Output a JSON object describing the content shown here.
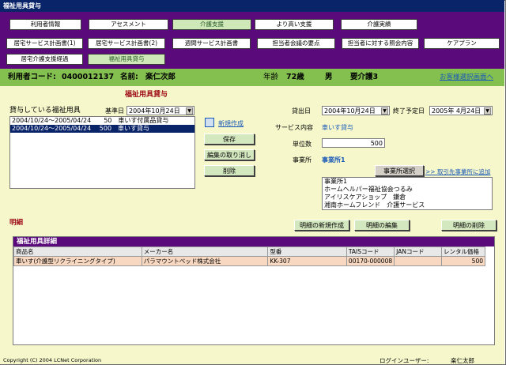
{
  "window": {
    "title": "福祉用具貸与"
  },
  "nav_top": [
    "利用者情報",
    "アセスメント",
    "介護支援",
    "より高い支援",
    "介護実績"
  ],
  "nav_sub": [
    "居宅サービス計画書(1)",
    "居宅サービス計画書(2)",
    "週間サービス計画書",
    "担当者会議の要点",
    "担当者に対する照会内容",
    "ケアプラン",
    "居宅介護支援経過",
    "福祉用具貸与"
  ],
  "patient": {
    "code_label": "利用者コード:",
    "code": "0400012137",
    "name_label": "名前:",
    "name": "楽仁次郎",
    "age_label": "年齢",
    "age": "72歳",
    "sex": "男",
    "care_level": "要介護3",
    "back_link": "お客様選択画面へ"
  },
  "section_title": "福祉用具貸与",
  "rental_list": {
    "label": "貸与している福祉用具",
    "base_date_label": "基準日",
    "base_date": "2004年10月24日",
    "rows": [
      "2004/10/24～2005/04/24　　50　車いす付属品貸与",
      "2004/10/24～2005/04/24　 500　車いす貸与"
    ]
  },
  "actions": {
    "new": "新規作成",
    "save": "保存",
    "cancel_edit": "編集の取り消し",
    "delete": "削除"
  },
  "form": {
    "start_label": "貸出日",
    "start_date": "2004年10月24日",
    "end_label": "終了予定日",
    "end_date": "2005年 4月24日",
    "service_label": "サービス内容",
    "service_value": "車いす貸与",
    "units_label": "単位数",
    "units_value": "500",
    "office_label": "事業所",
    "office_value": "事業所1",
    "office_select": "事業所選択",
    "add_supplier": ">> 取引先事業所に追加",
    "offices": [
      "事業所1",
      "ホームヘルパー福祉協会つるみ",
      "アイリスケアショップ　鎌倉",
      "湘南ホームフレンド　介護サービス"
    ]
  },
  "detail": {
    "label": "明細",
    "new": "明細の新規作成",
    "edit": "明細の編集",
    "delete": "明細の削除",
    "grid_title": "福祉用具詳細",
    "columns": [
      "商品名",
      "メーカー名",
      "型番",
      "TAISコード",
      "JANコード",
      "レンタル価格"
    ],
    "rows": [
      [
        "車いす(介護型リクライニングタイプ)",
        "パラマウントベッド株式会社",
        "KK-307",
        "00170-000008",
        "",
        "500"
      ]
    ]
  },
  "footer": {
    "copyright": "Copyright (C) 2004 LCNet Corporation",
    "login_label": "ログインユーザー:",
    "login_user": "楽仁太郎"
  }
}
